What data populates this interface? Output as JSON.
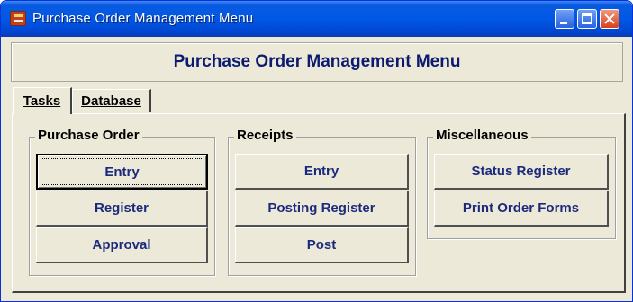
{
  "window": {
    "title": "Purchase Order Management Menu",
    "icon": "app-icon"
  },
  "titlebar_buttons": {
    "minimize": "minimize-icon",
    "maximize": "maximize-icon",
    "close": "close-icon"
  },
  "header": {
    "title": "Purchase Order Management Menu"
  },
  "tabs": [
    {
      "label": "Tasks",
      "active": true
    },
    {
      "label": "Database",
      "active": false
    }
  ],
  "groups": {
    "purchase_order": {
      "label": "Purchase Order",
      "buttons": [
        "Entry",
        "Register",
        "Approval"
      ]
    },
    "receipts": {
      "label": "Receipts",
      "buttons": [
        "Entry",
        "Posting Register",
        "Post"
      ]
    },
    "miscellaneous": {
      "label": "Miscellaneous",
      "buttons": [
        "Status Register",
        "Print Order Forms"
      ]
    }
  },
  "colors": {
    "titlebar": "#0058e6",
    "window_bg": "#ece9d8",
    "button_text": "#1b2a7d",
    "header_text": "#0c1b70"
  }
}
